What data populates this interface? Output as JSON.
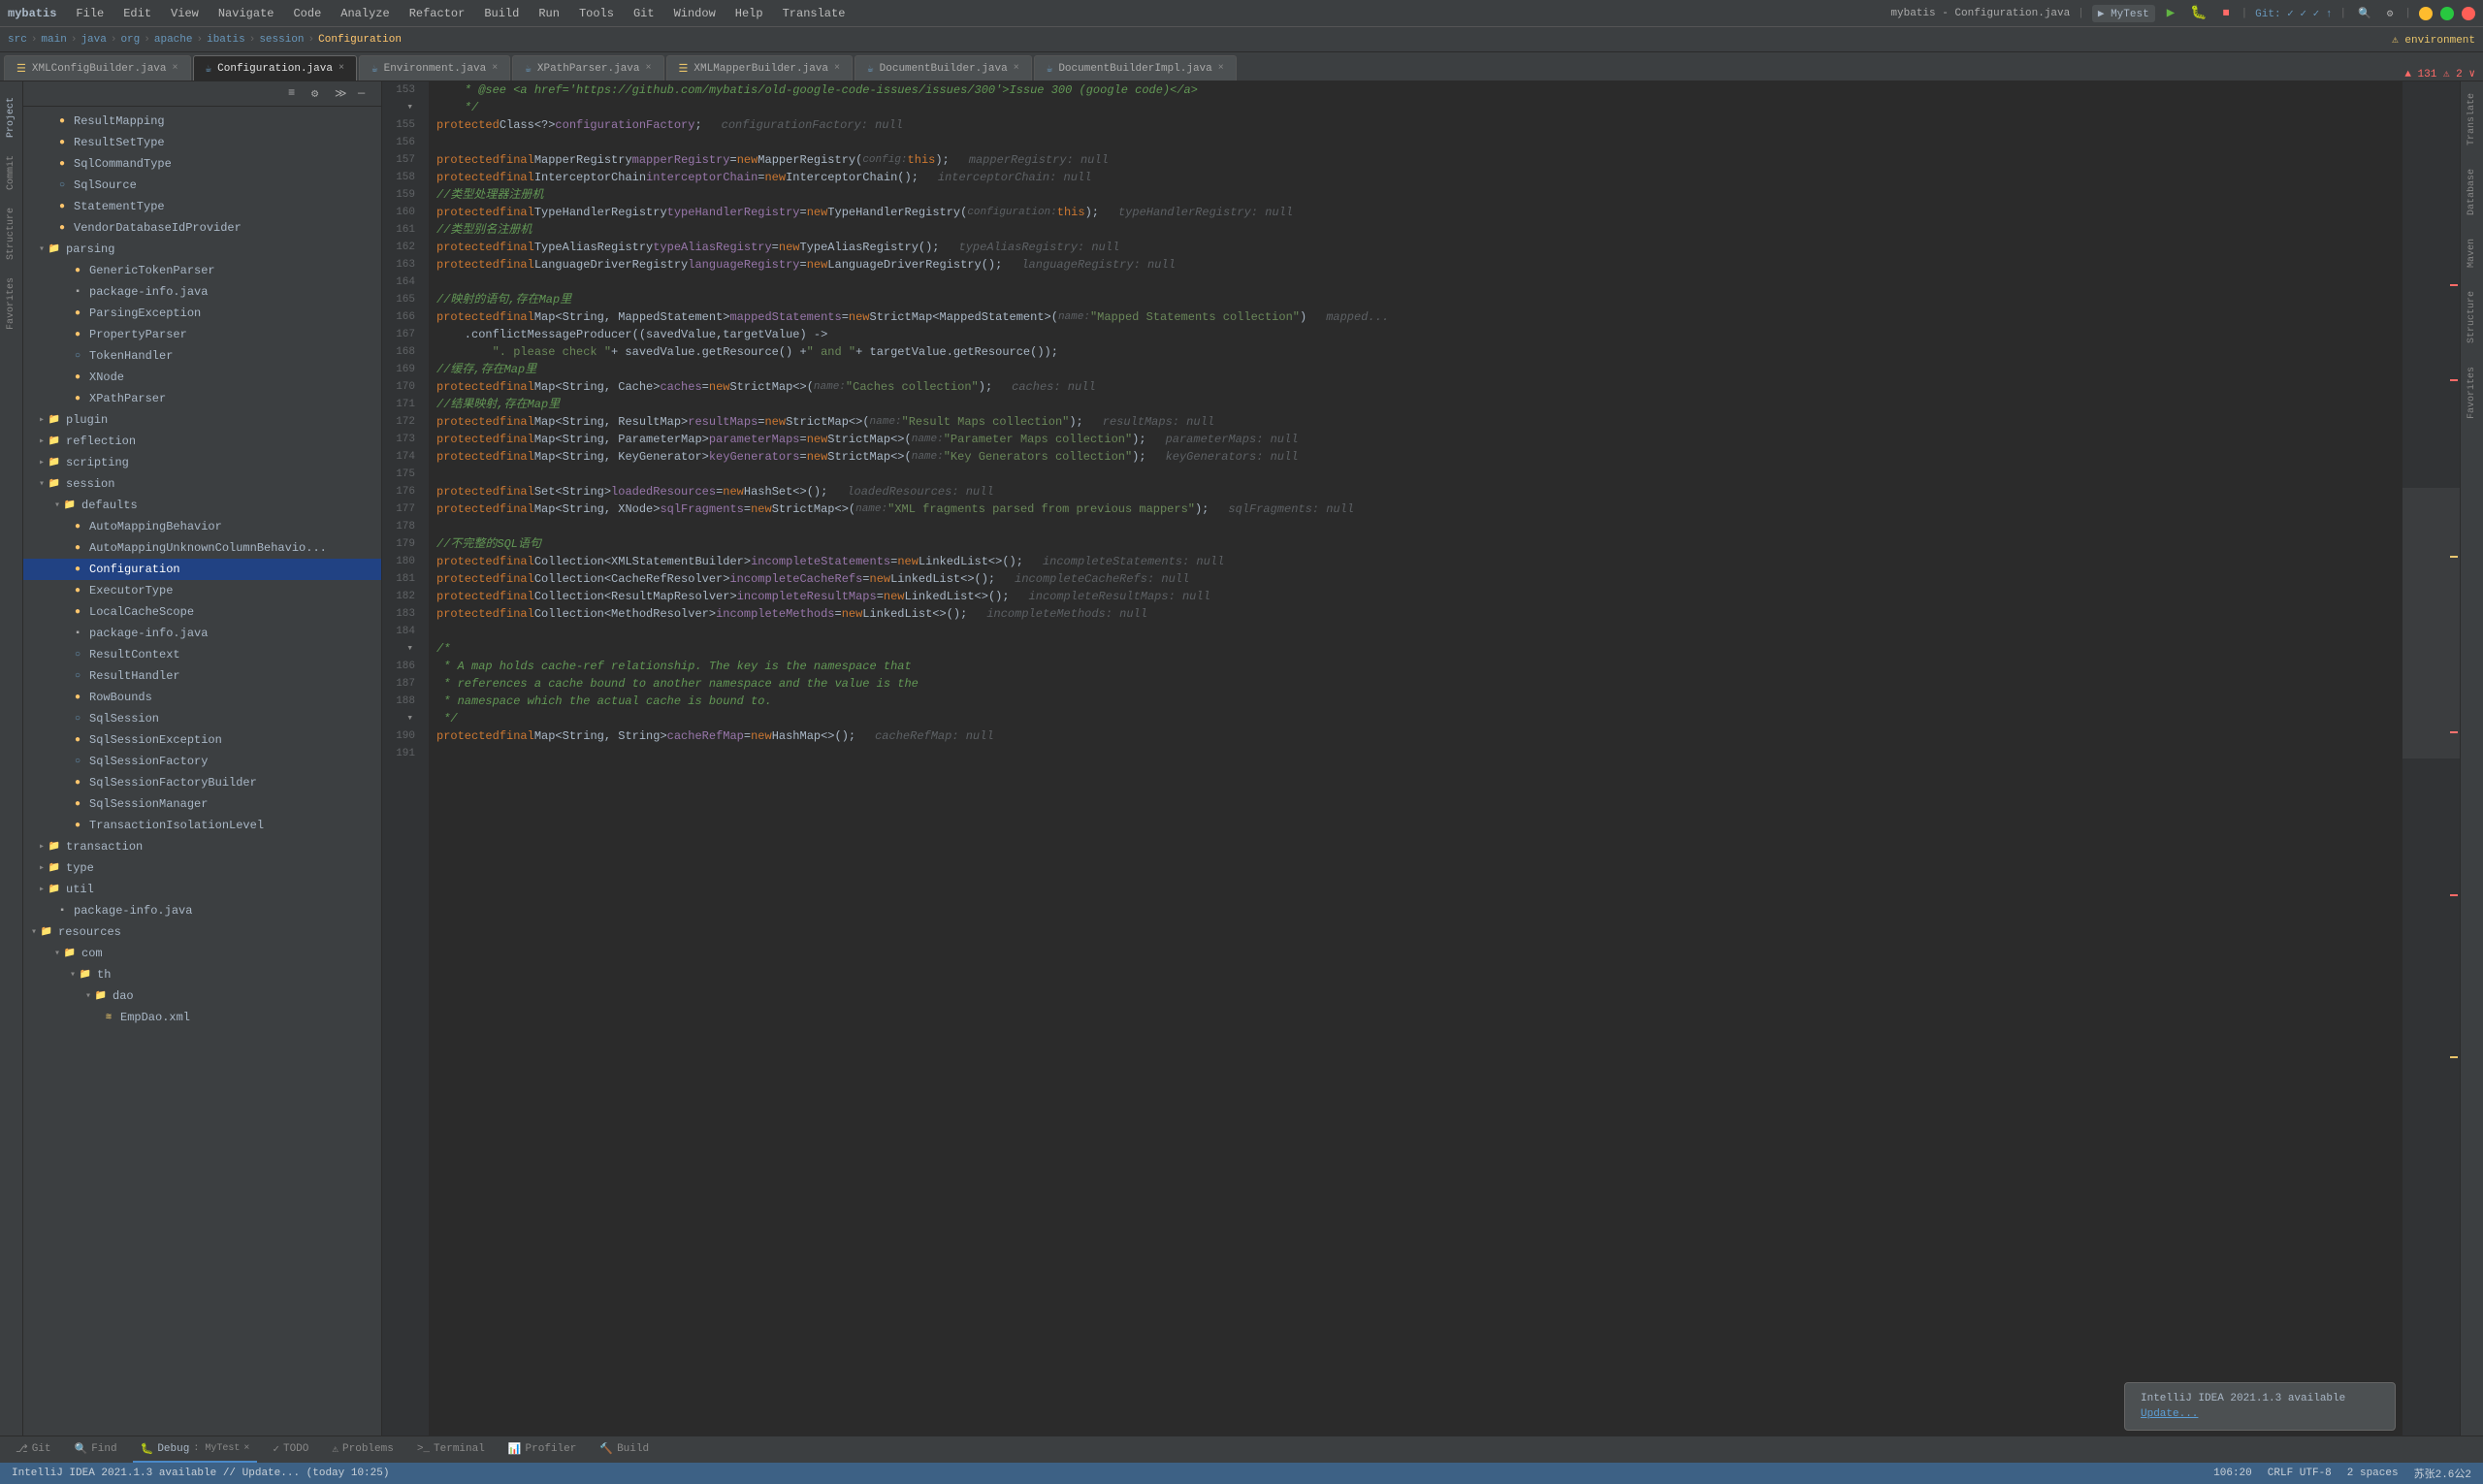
{
  "app": {
    "name": "mybatis",
    "title": "mybatis - Configuration.java",
    "window_controls": [
      "close",
      "minimize",
      "maximize"
    ]
  },
  "menu": {
    "items": [
      "File",
      "Edit",
      "View",
      "Navigate",
      "Code",
      "Analyze",
      "Refactor",
      "Build",
      "Run",
      "Tools",
      "Git",
      "Window",
      "Help",
      "Translate"
    ]
  },
  "toolbar": {
    "project_label": "mybatis",
    "run_config": "MyTest",
    "git_label": "Git:",
    "search_label": "🔍"
  },
  "breadcrumb": {
    "items": [
      "src",
      "main",
      "java",
      "org",
      "apache",
      "ibatis",
      "session",
      "Configuration"
    ],
    "environment": "environment"
  },
  "tabs": [
    {
      "label": "XMLConfigBuilder.java",
      "type": "xml",
      "active": false,
      "modified": false
    },
    {
      "label": "Configuration.java",
      "type": "java",
      "active": true,
      "modified": false
    },
    {
      "label": "Environment.java",
      "type": "java",
      "active": false
    },
    {
      "label": "XPathParser.java",
      "type": "java",
      "active": false
    },
    {
      "label": "XMLMapperBuilder.java",
      "type": "xml",
      "active": false
    },
    {
      "label": "DocumentBuilder.java",
      "type": "java",
      "active": false
    },
    {
      "label": "DocumentBuilderImpl.java",
      "type": "java",
      "active": false
    }
  ],
  "tree": {
    "header": "Project",
    "items": [
      {
        "label": "ResultMapping",
        "indent": 2,
        "type": "class",
        "icon": "C"
      },
      {
        "label": "ResultSetType",
        "indent": 2,
        "type": "enum",
        "icon": "E"
      },
      {
        "label": "SqlCommandType",
        "indent": 2,
        "type": "enum",
        "icon": "E"
      },
      {
        "label": "SqlSource",
        "indent": 2,
        "type": "interface",
        "icon": "I"
      },
      {
        "label": "StatementType",
        "indent": 2,
        "type": "enum",
        "icon": "E"
      },
      {
        "label": "VendorDatabaseIdProvider",
        "indent": 2,
        "type": "class",
        "icon": "C"
      },
      {
        "label": "parsing",
        "indent": 1,
        "type": "folder",
        "expanded": true
      },
      {
        "label": "GenericTokenParser",
        "indent": 3,
        "type": "class",
        "icon": "C"
      },
      {
        "label": "package-info.java",
        "indent": 3,
        "type": "java"
      },
      {
        "label": "ParsingException",
        "indent": 3,
        "type": "class",
        "icon": "C"
      },
      {
        "label": "PropertyParser",
        "indent": 3,
        "type": "class",
        "icon": "C"
      },
      {
        "label": "TokenHandler",
        "indent": 3,
        "type": "interface",
        "icon": "I"
      },
      {
        "label": "XNode",
        "indent": 3,
        "type": "class",
        "icon": "C"
      },
      {
        "label": "XPathParser",
        "indent": 3,
        "type": "class",
        "icon": "C"
      },
      {
        "label": "plugin",
        "indent": 1,
        "type": "folder",
        "expanded": false
      },
      {
        "label": "reflection",
        "indent": 1,
        "type": "folder",
        "expanded": false
      },
      {
        "label": "scripting",
        "indent": 1,
        "type": "folder",
        "expanded": false
      },
      {
        "label": "session",
        "indent": 1,
        "type": "folder",
        "expanded": true
      },
      {
        "label": "defaults",
        "indent": 2,
        "type": "folder",
        "expanded": true
      },
      {
        "label": "AutoMappingBehavior",
        "indent": 3,
        "type": "enum",
        "icon": "E"
      },
      {
        "label": "AutoMappingUnknownColumnBehavior",
        "indent": 3,
        "type": "class",
        "icon": "C"
      },
      {
        "label": "Configuration",
        "indent": 3,
        "type": "class",
        "icon": "C",
        "selected": true
      },
      {
        "label": "ExecutorType",
        "indent": 3,
        "type": "enum",
        "icon": "E"
      },
      {
        "label": "LocalCacheScope",
        "indent": 3,
        "type": "enum",
        "icon": "E"
      },
      {
        "label": "package-info.java",
        "indent": 3,
        "type": "java"
      },
      {
        "label": "ResultContext",
        "indent": 3,
        "type": "interface",
        "icon": "I"
      },
      {
        "label": "ResultHandler",
        "indent": 3,
        "type": "interface",
        "icon": "I"
      },
      {
        "label": "RowBounds",
        "indent": 3,
        "type": "class",
        "icon": "C"
      },
      {
        "label": "SqlSession",
        "indent": 3,
        "type": "interface",
        "icon": "I"
      },
      {
        "label": "SqlSessionException",
        "indent": 3,
        "type": "class",
        "icon": "C"
      },
      {
        "label": "SqlSessionFactory",
        "indent": 3,
        "type": "interface",
        "icon": "I"
      },
      {
        "label": "SqlSessionFactoryBuilder",
        "indent": 3,
        "type": "class",
        "icon": "C"
      },
      {
        "label": "SqlSessionManager",
        "indent": 3,
        "type": "class",
        "icon": "C"
      },
      {
        "label": "TransactionIsolationLevel",
        "indent": 3,
        "type": "enum",
        "icon": "E"
      },
      {
        "label": "transaction",
        "indent": 1,
        "type": "folder",
        "expanded": false
      },
      {
        "label": "type",
        "indent": 1,
        "type": "folder",
        "expanded": false
      },
      {
        "label": "util",
        "indent": 1,
        "type": "folder",
        "expanded": false
      },
      {
        "label": "package-info.java",
        "indent": 2,
        "type": "java"
      },
      {
        "label": "resources",
        "indent": 0,
        "type": "folder",
        "expanded": true
      },
      {
        "label": "com",
        "indent": 1,
        "type": "folder",
        "expanded": true
      },
      {
        "label": "th",
        "indent": 2,
        "type": "folder",
        "expanded": true
      },
      {
        "label": "dao",
        "indent": 3,
        "type": "folder",
        "expanded": true
      },
      {
        "label": "EmpDao.xml",
        "indent": 4,
        "type": "xml"
      }
    ]
  },
  "editor": {
    "filename": "Configuration.java",
    "error_count": 131,
    "warning_count": 2,
    "lines": [
      {
        "num": 153,
        "content": "  * @see <a href='https://github.com/mybatis/old-google-code-issues/issues/300'>Issue 300 (google code)</a>"
      },
      {
        "num": 154,
        "content": "  */"
      },
      {
        "num": 155,
        "content": "protected Class<?> configurationFactory;",
        "hint": "configurationFactory: null"
      },
      {
        "num": 156,
        "content": ""
      },
      {
        "num": 157,
        "content": "protected final MapperRegistry mapperRegistry = new MapperRegistry( config: this);",
        "hint": "mapperRegistry: null"
      },
      {
        "num": 158,
        "content": "protected final InterceptorChain interceptorChain = new InterceptorChain();",
        "hint": "interceptorChain: null"
      },
      {
        "num": 159,
        "content": "//类型处理器注册机"
      },
      {
        "num": 160,
        "content": "protected final TypeHandlerRegistry typeHandlerRegistry = new TypeHandlerRegistry( configuration: this);",
        "hint": "typeHandlerRegistry: null"
      },
      {
        "num": 161,
        "content": "//类型别名注册机"
      },
      {
        "num": 162,
        "content": "protected final TypeAliasRegistry typeAliasRegistry = new TypeAliasRegistry();",
        "hint": "typeAliasRegistry: null"
      },
      {
        "num": 163,
        "content": "protected final LanguageDriverRegistry languageRegistry = new LanguageDriverRegistry();",
        "hint": "languageRegistry: null"
      },
      {
        "num": 164,
        "content": ""
      },
      {
        "num": 165,
        "content": "//映射的语句,存在Map里"
      },
      {
        "num": 166,
        "content": "protected final Map<String, MappedStatement> mappedStatements = new StrictMap<MappedStatement>( name: \"Mapped Statements collection\")",
        "hint": "mapped..."
      },
      {
        "num": 167,
        "content": "  .conflictMessageProducer((savedValue, targetValue) ->"
      },
      {
        "num": 168,
        "content": "    \". please check \" + savedValue.getResource() + \" and \" + targetValue.getResource());"
      },
      {
        "num": 169,
        "content": "//缓存,存在Map里"
      },
      {
        "num": 170,
        "content": "protected final Map<String, Cache> caches = new StrictMap<>( name: \"Caches collection\");",
        "hint": "caches: null"
      },
      {
        "num": 171,
        "content": "//结果映射,存在Map里"
      },
      {
        "num": 172,
        "content": "protected final Map<String, ResultMap> resultMaps = new StrictMap<>( name: \"Result Maps collection\");",
        "hint": "resultMaps: null"
      },
      {
        "num": 173,
        "content": "protected final Map<String, ParameterMap> parameterMaps = new StrictMap<>( name: \"Parameter Maps collection\");",
        "hint": "parameterMaps: null"
      },
      {
        "num": 174,
        "content": "protected final Map<String, KeyGenerator> keyGenerators = new StrictMap<>( name: \"Key Generators collection\");",
        "hint": "keyGenerators: null"
      },
      {
        "num": 175,
        "content": ""
      },
      {
        "num": 176,
        "content": "protected final Set<String> loadedResources = new HashSet<>();",
        "hint": "loadedResources: null"
      },
      {
        "num": 177,
        "content": "protected final Map<String, XNode> sqlFragments = new StrictMap<>( name: \"XML fragments parsed from previous mappers\");",
        "hint": "sqlFragments: null"
      },
      {
        "num": 178,
        "content": ""
      },
      {
        "num": 179,
        "content": "//不完整的SQL语句"
      },
      {
        "num": 180,
        "content": "protected final Collection<XMLStatementBuilder> incompleteStatements = new LinkedList<>();",
        "hint": "incompleteStatements: null"
      },
      {
        "num": 181,
        "content": "protected final Collection<CacheRefResolver> incompleteCacheRefs = new LinkedList<>();",
        "hint": "incompleteCacheRefs: null"
      },
      {
        "num": 182,
        "content": "protected final Collection<ResultMapResolver> incompleteResultMaps = new LinkedList<>();",
        "hint": "incompleteResultMaps: null"
      },
      {
        "num": 183,
        "content": "protected final Collection<MethodResolver> incompleteMethods = new LinkedList<>();",
        "hint": "incompleteMethods: null"
      },
      {
        "num": 184,
        "content": ""
      },
      {
        "num": 185,
        "content": "/*"
      },
      {
        "num": 186,
        "content": " * A map holds cache-ref relationship. The key is the namespace that"
      },
      {
        "num": 187,
        "content": " * references a cache bound to another namespace and the value is the"
      },
      {
        "num": 188,
        "content": " * namespace which the actual cache is bound to."
      },
      {
        "num": 189,
        "content": " */"
      },
      {
        "num": 190,
        "content": "protected final Map<String, String> cacheRefMap = new HashMap<>();",
        "hint": "cacheRefMap: null"
      },
      {
        "num": 191,
        "content": ""
      }
    ]
  },
  "bottom_tabs": [
    {
      "label": "Git",
      "icon": "git",
      "active": false
    },
    {
      "label": "Find",
      "icon": "find",
      "active": false
    },
    {
      "label": "Debug",
      "icon": "debug",
      "active": true
    },
    {
      "label": "TODO",
      "icon": "todo",
      "active": false
    },
    {
      "label": "Problems",
      "icon": "problems",
      "active": false
    },
    {
      "label": "Terminal",
      "icon": "terminal",
      "active": false
    },
    {
      "label": "Profiler",
      "icon": "profiler",
      "active": false
    },
    {
      "label": "Build",
      "icon": "build",
      "active": false
    }
  ],
  "debug": {
    "session": "MyTest"
  },
  "status": {
    "git": "Git",
    "find": "Find",
    "debug_session": "MyTest",
    "notification": "IntelliJ IDEA 2021.1.3 available // Update... (today 10:25)",
    "position": "106:20",
    "encoding": "CRLF  UTF-8",
    "indent": "2 spaces",
    "right_info": "苏张2.6公2"
  },
  "notification": {
    "title": "IntelliJ IDEA 2021.1.3 available",
    "link": "Update..."
  },
  "right_panel": {
    "labels": [
      "Translate",
      "Database",
      "Maven",
      "Structure",
      "Favorites"
    ]
  }
}
